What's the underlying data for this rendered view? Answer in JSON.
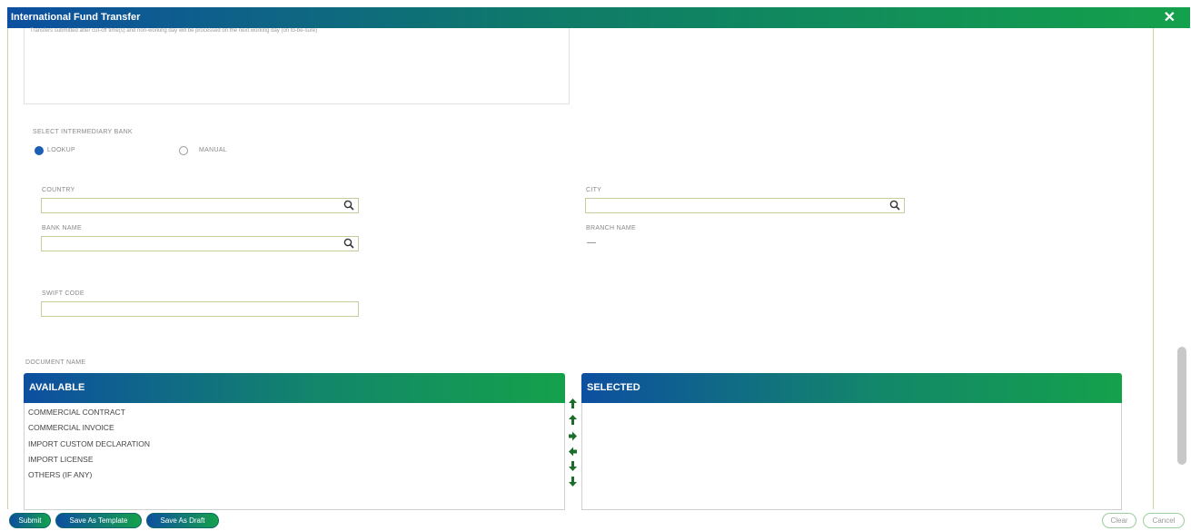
{
  "window": {
    "title": "International Fund Transfer",
    "close_label": "✕"
  },
  "notice": {
    "text": "Transfers submitted after cut-off time(s) and non-working day will be processed on the next working day (on to-be-sure)"
  },
  "intermediary": {
    "label": "SELECT INTERMEDIARY BANK",
    "options": [
      {
        "label": "LOOKUP",
        "checked": true
      },
      {
        "label": "MANUAL",
        "checked": false
      }
    ]
  },
  "fields": {
    "country": {
      "label": "COUNTRY",
      "value": ""
    },
    "city": {
      "label": "CITY",
      "value": ""
    },
    "bank_name": {
      "label": "BANK NAME",
      "value": ""
    },
    "branch_name": {
      "label": "BRANCH NAME",
      "value": "—"
    },
    "swift_code": {
      "label": "SWIFT CODE",
      "value": ""
    }
  },
  "documents": {
    "label": "DOCUMENT NAME",
    "available_header": "AVAILABLE",
    "selected_header": "SELECTED",
    "available": [
      "COMMERCIAL CONTRACT",
      "COMMERCIAL INVOICE",
      "IMPORT CUSTOM DECLARATION",
      "IMPORT LICENSE",
      "OTHERS (IF ANY)"
    ],
    "selected": []
  },
  "actions": {
    "submit": "Submit",
    "save_template": "Save As Template",
    "save_draft": "Save As Draft",
    "clear": "Clear",
    "cancel": "Cancel"
  },
  "colors": {
    "gradient_start": "#0d4fa0",
    "gradient_end": "#14a14b"
  }
}
